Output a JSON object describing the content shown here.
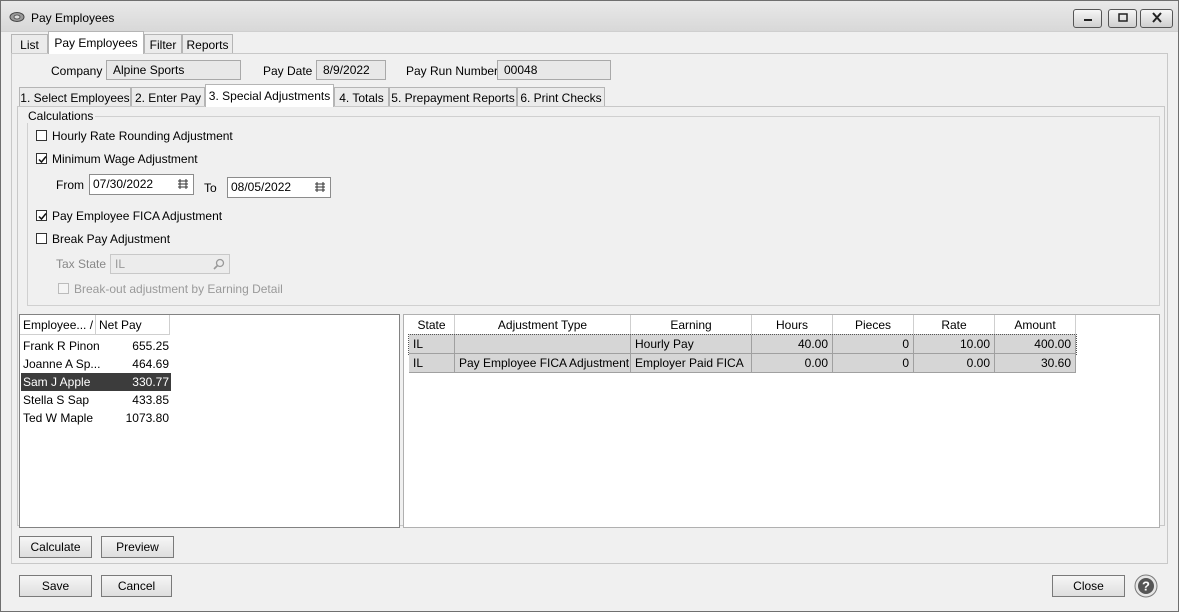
{
  "window": {
    "title": "Pay Employees",
    "controls": [
      "minimize-icon",
      "maximize-icon",
      "close-icon"
    ]
  },
  "top_tabs": [
    "List",
    "Pay Employees",
    "Filter",
    "Reports"
  ],
  "header": {
    "company_label": "Company",
    "company_value": "Alpine Sports",
    "paydate_label": "Pay Date",
    "paydate_value": "8/9/2022",
    "payrun_label": "Pay Run Number",
    "payrun_value": "00048"
  },
  "step_tabs": [
    "1. Select Employees",
    "2. Enter Pay",
    "3. Special Adjustments",
    "4. Totals",
    "5. Prepayment Reports",
    "6. Print Checks"
  ],
  "calculations": {
    "group_label": "Calculations",
    "hourly_rounding": {
      "label": "Hourly Rate Rounding Adjustment",
      "checked": false
    },
    "minimum_wage": {
      "label": "Minimum Wage Adjustment",
      "checked": true
    },
    "from_label": "From",
    "from_value": "07/30/2022",
    "to_label": "To",
    "to_value": "08/05/2022",
    "fica": {
      "label": "Pay Employee FICA Adjustment",
      "checked": true
    },
    "break_pay": {
      "label": "Break Pay Adjustment",
      "checked": false
    },
    "tax_state_label": "Tax State",
    "tax_state_value": "IL",
    "breakout": {
      "label": "Break-out adjustment by Earning Detail",
      "checked": false
    }
  },
  "employees": {
    "headers": [
      "Employee... /",
      "Net Pay"
    ],
    "rows": [
      {
        "name": "Frank R Pinon",
        "net": "655.25"
      },
      {
        "name": "Joanne A Sp...",
        "net": "464.69"
      },
      {
        "name": "Sam J Apple",
        "net": "330.77"
      },
      {
        "name": "Stella S Sap",
        "net": "433.85"
      },
      {
        "name": "Ted W Maple",
        "net": "1073.80"
      }
    ]
  },
  "adjustments": {
    "headers": [
      "State",
      "Adjustment Type",
      "Earning",
      "Hours",
      "Pieces",
      "Rate",
      "Amount"
    ],
    "rows": [
      {
        "state": "IL",
        "type": "",
        "earning": "Hourly Pay",
        "hours": "40.00",
        "pieces": "0",
        "rate": "10.00",
        "amount": "400.00"
      },
      {
        "state": "IL",
        "type": "Pay Employee FICA Adjustment",
        "earning": "Employer Paid FICA",
        "hours": "0.00",
        "pieces": "0",
        "rate": "0.00",
        "amount": "30.60"
      }
    ]
  },
  "buttons": {
    "calculate": "Calculate",
    "preview": "Preview",
    "save": "Save",
    "cancel": "Cancel",
    "close": "Close"
  },
  "colors": {
    "selected_row": "#3c3c3c",
    "grid_row": "#d6d6d6"
  }
}
